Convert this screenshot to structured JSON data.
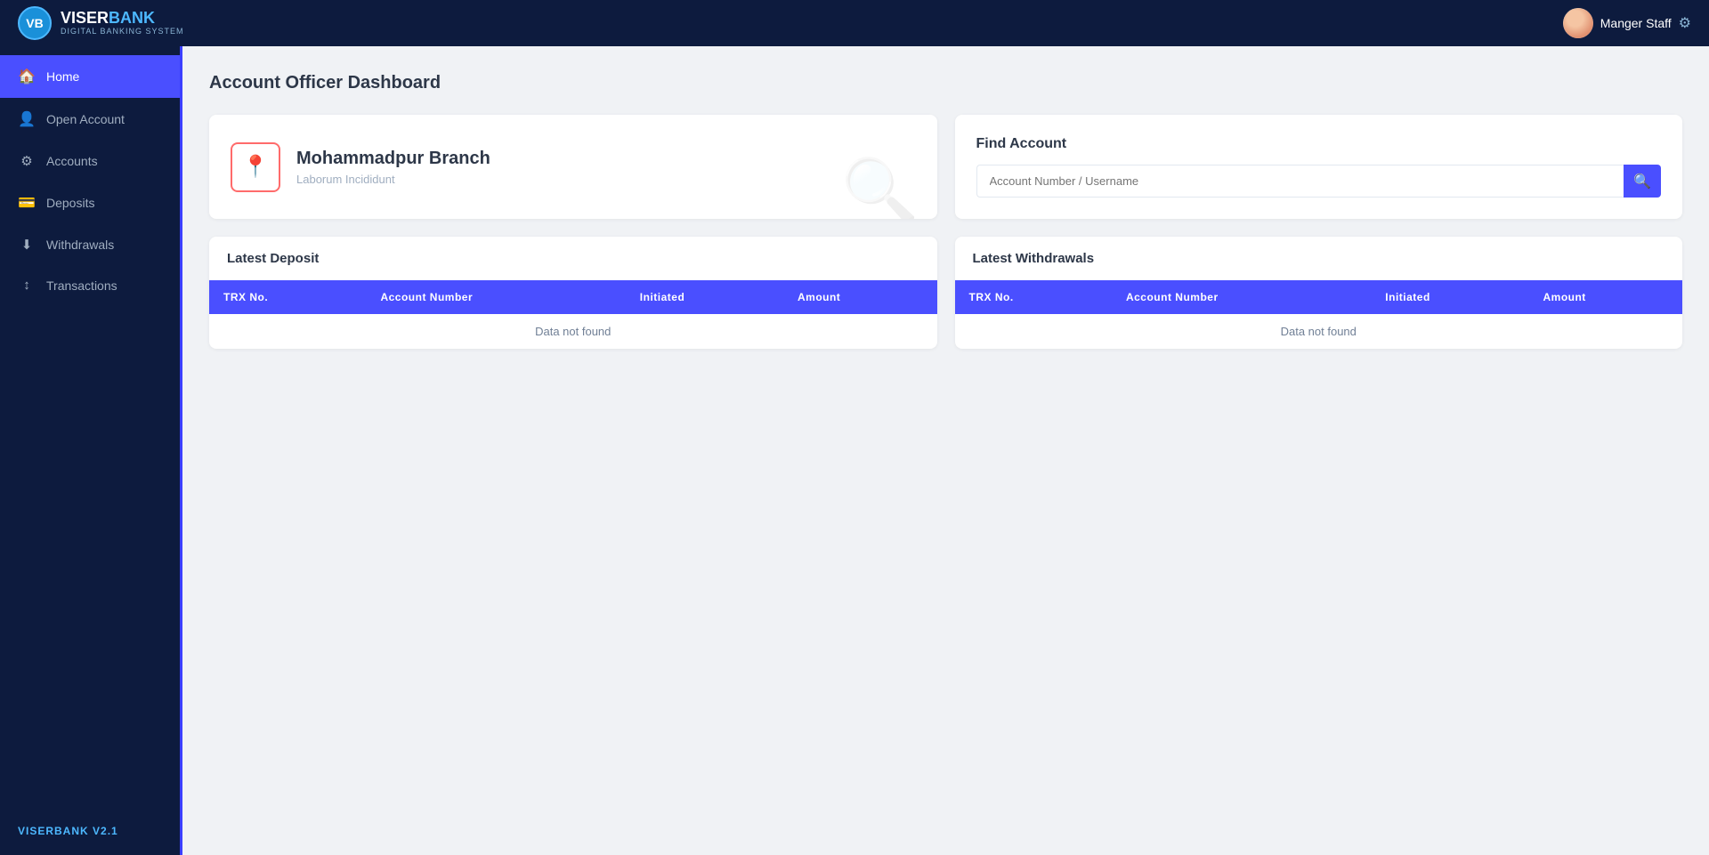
{
  "header": {
    "logo_name_part1": "VISER",
    "logo_name_part2": "BANK",
    "logo_subtitle": "DIGITAL BANKING SYSTEM",
    "logo_initials": "VB",
    "user_name": "Manger Staff",
    "settings_icon": "⚙"
  },
  "sidebar": {
    "items": [
      {
        "id": "home",
        "label": "Home",
        "icon": "🏠",
        "active": true
      },
      {
        "id": "open-account",
        "label": "Open Account",
        "icon": "👤",
        "active": false
      },
      {
        "id": "accounts",
        "label": "Accounts",
        "icon": "⚙",
        "active": false
      },
      {
        "id": "deposits",
        "label": "Deposits",
        "icon": "💳",
        "active": false
      },
      {
        "id": "withdrawals",
        "label": "Withdrawals",
        "icon": "⬇",
        "active": false
      },
      {
        "id": "transactions",
        "label": "Transactions",
        "icon": "↕",
        "active": false
      }
    ],
    "version": "VISERBANK V2.1"
  },
  "main": {
    "page_title": "Account Officer Dashboard",
    "branch": {
      "name": "Mohammadpur Branch",
      "subtitle": "Laborum Incididunt"
    },
    "find_account": {
      "title": "Find Account",
      "input_placeholder": "Account Number / Username",
      "search_icon": "🔍"
    },
    "latest_deposit": {
      "title": "Latest Deposit",
      "columns": [
        "TRX No.",
        "Account Number",
        "Initiated",
        "Amount"
      ],
      "empty_message": "Data not found",
      "rows": []
    },
    "latest_withdrawals": {
      "title": "Latest Withdrawals",
      "columns": [
        "TRX No.",
        "Account Number",
        "Initiated",
        "Amount"
      ],
      "empty_message": "Data not found",
      "rows": []
    }
  }
}
